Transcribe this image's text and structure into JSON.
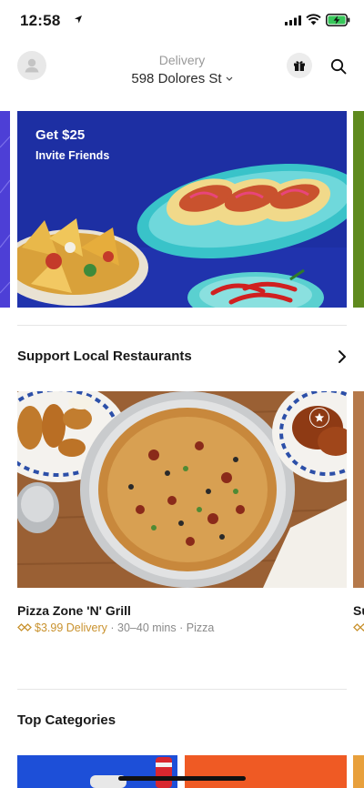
{
  "status_bar": {
    "time": "12:58"
  },
  "header": {
    "delivery_label": "Delivery",
    "address": "598 Dolores St"
  },
  "promo": {
    "title": "Get $25",
    "subtitle": "Invite Friends"
  },
  "sections": {
    "support_local": {
      "title": "Support Local Restaurants"
    },
    "top_categories": {
      "title": "Top Categories"
    }
  },
  "stores": [
    {
      "name": "Pizza Zone 'N' Grill",
      "delivery_fee": "$3.99 Delivery",
      "details": " · 30–40 mins · Pizza"
    },
    {
      "name": "Su"
    }
  ],
  "colors": {
    "accent_fee": "#c9922e",
    "promo_bg": "#1d2fa3"
  },
  "icons": {
    "gift": "gift-icon",
    "search": "search-icon",
    "avatar": "person-icon",
    "favorite": "star-icon",
    "section_chevron": "chevron-right-icon",
    "dashpass": "dashpass-icon"
  }
}
